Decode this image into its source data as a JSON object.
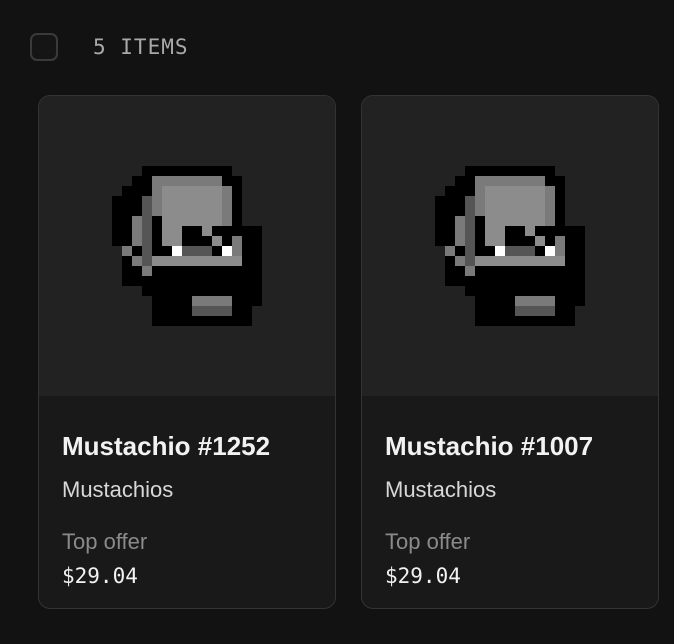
{
  "header": {
    "item_count": "5 ITEMS"
  },
  "colors": {
    "background": "#121212",
    "card_background": "#191919",
    "media_background": "#222222",
    "card_border": "#333333"
  },
  "cards": [
    {
      "title": "Mustachio #1252",
      "collection": "Mustachios",
      "offer_label": "Top offer",
      "price": "$29.04",
      "icon": "pixel-skull-mustache-icon"
    },
    {
      "title": "Mustachio #1007",
      "collection": "Mustachios",
      "offer_label": "Top offer",
      "price": "$29.04",
      "icon": "pixel-skull-mustache-icon"
    }
  ]
}
